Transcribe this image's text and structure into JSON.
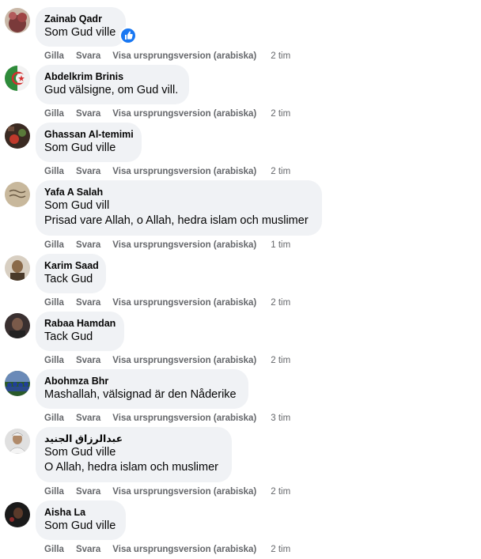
{
  "actions": {
    "like": "Gilla",
    "reply": "Svara",
    "see_original": "Visa ursprungsversion (arabiska)"
  },
  "comments": [
    {
      "author": "Zainab Qadr",
      "lines": [
        "Som Gud ville"
      ],
      "time": "2 tim",
      "avatar_color": "#7a3a3a",
      "reaction": "like-icon"
    },
    {
      "author": "Abdelkrim Brinis",
      "lines": [
        "Gud välsigne, om Gud vill."
      ],
      "time": "2 tim",
      "avatar_color": "#2e8b3a"
    },
    {
      "author": "Ghassan Al-temimi",
      "lines": [
        "Som Gud ville"
      ],
      "time": "2 tim",
      "avatar_color": "#3a2a22"
    },
    {
      "author": "Yafa A Salah",
      "lines": [
        "Som Gud vill",
        "Prisad vare Allah, o Allah, hedra islam och muslimer"
      ],
      "time": "1 tim",
      "avatar_color": "#b9a68c"
    },
    {
      "author": "Karim Saad",
      "lines": [
        "Tack Gud"
      ],
      "time": "2 tim",
      "avatar_color": "#8a7a6a"
    },
    {
      "author": "Rabaa Hamdan",
      "lines": [
        "Tack Gud"
      ],
      "time": "2 tim",
      "avatar_color": "#4a3a3a"
    },
    {
      "author": "Abohmza Bhr",
      "lines": [
        "Mashallah, välsignad är den Nåderike"
      ],
      "time": "3 tim",
      "avatar_color": "#1f3f7a"
    },
    {
      "author": "عبدالرزاق الجنيد",
      "lines": [
        "Som Gud ville",
        "O Allah, hedra islam och muslimer"
      ],
      "time": "2 tim",
      "avatar_color": "#d8d8d8"
    },
    {
      "author": "Aisha La",
      "lines": [
        "Som Gud ville"
      ],
      "time": "2 tim",
      "avatar_color": "#1a1a1a"
    }
  ]
}
